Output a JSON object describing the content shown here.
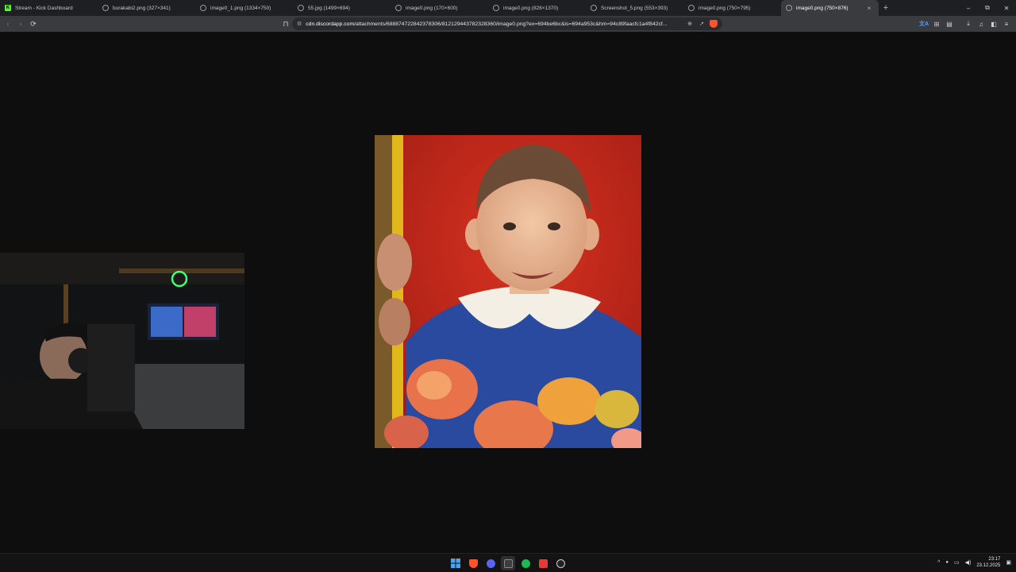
{
  "tabs": [
    {
      "label": "Stream - Kick Dashboard",
      "favicon": "kick-logo-icon",
      "active": false
    },
    {
      "label": "burakabi2.png (327×341)",
      "favicon": "globe-icon",
      "active": false
    },
    {
      "label": "image0_1.png (1334×750)",
      "favicon": "globe-icon",
      "active": false
    },
    {
      "label": "55.jpg (1499×694)",
      "favicon": "globe-icon",
      "active": false
    },
    {
      "label": "image0.png (170×600)",
      "favicon": "globe-icon",
      "active": false
    },
    {
      "label": "image0.png (828×1370)",
      "favicon": "globe-icon",
      "active": false
    },
    {
      "label": "Screenshot_5.png (553×393)",
      "favicon": "globe-icon",
      "active": false
    },
    {
      "label": "image0.png (750×795)",
      "favicon": "globe-icon",
      "active": false
    },
    {
      "label": "image0.png (750×876)",
      "favicon": "globe-icon",
      "active": true
    }
  ],
  "kick_glyph": "K",
  "new_tab": "+",
  "window_controls": {
    "minimize": "–",
    "restore": "⧉",
    "close": "✕"
  },
  "tab_close": "×",
  "toolbar": {
    "url_host": "cdn.discordapp.com",
    "url_path": "/attachments/688874722842378306/812129443782328360/image0.png?ex=694be6bc&is=694a953c&hm=94c89faacfc1a4f842cf..."
  },
  "icons": {
    "back": "‹",
    "forward": "›",
    "reload": "⟳",
    "bookmark": "⊓",
    "site_settings": "⚙",
    "zoom": "⊕",
    "share": "↗",
    "translate": "文A",
    "extensions": "⊞",
    "reading_list": "▤",
    "download": "⤓",
    "media": "♫",
    "sidebar": "◧",
    "menu": "≡"
  },
  "taskbar": {
    "apps": [
      {
        "name": "windows-start",
        "color": "#4aa3f0"
      },
      {
        "name": "brave-browser",
        "color": "#fb542b"
      },
      {
        "name": "discord",
        "color": "#5865f2"
      },
      {
        "name": "terminal",
        "color": "#3c3c3c"
      },
      {
        "name": "spotify",
        "color": "#1db954"
      },
      {
        "name": "calendar-app",
        "color": "#e03a3a"
      },
      {
        "name": "obs-studio",
        "color": "#cfcfcf"
      }
    ],
    "time": "23:17",
    "date": "23.12.2025",
    "tray_icons": {
      "chevron": "^",
      "mic": "🎙",
      "network": "▭",
      "volume": "🔊",
      "notifications": "🔔"
    }
  },
  "colors": {
    "page_bg": "#0e0e0f",
    "tab_strip": "#1e1f22",
    "toolbar": "#3a3b3f",
    "photo_background_red": "#c1271c"
  }
}
